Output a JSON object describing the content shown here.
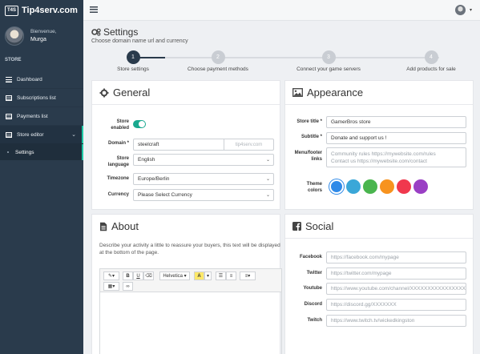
{
  "app": {
    "brand": "Tip4serv.com",
    "logo_text": "T4S"
  },
  "user": {
    "greeting": "Bienvenue,",
    "name": "Murga"
  },
  "sidebar": {
    "section_label": "STORE",
    "items": [
      {
        "label": "Dashboard",
        "icon": "dashboard-icon"
      },
      {
        "label": "Subscriptions list",
        "icon": "list-icon"
      },
      {
        "label": "Payments list",
        "icon": "list-icon"
      },
      {
        "label": "Store editor",
        "icon": "grid-icon",
        "expanded": true
      }
    ],
    "subitems": [
      {
        "label": "Settings"
      }
    ]
  },
  "page": {
    "title": "Settings",
    "subtitle": "Choose domain name url and currency"
  },
  "steps": [
    {
      "number": "1",
      "label": "Store settings",
      "active": true
    },
    {
      "number": "2",
      "label": "Choose payment methods",
      "active": false
    },
    {
      "number": "3",
      "label": "Connect your game servers",
      "active": false
    },
    {
      "number": "4",
      "label": "Add products for sale",
      "active": false
    }
  ],
  "general": {
    "title": "General",
    "store_enabled_label": "Store enabled",
    "store_enabled": true,
    "domain_label": "Domain *",
    "domain_value": "steelcraft",
    "domain_suffix": "tip4serv.com",
    "language_label": "Store language",
    "language_value": "English",
    "timezone_label": "Timezone",
    "timezone_value": "Europe/Berlin",
    "currency_label": "Currency",
    "currency_value": "Please Select Currency"
  },
  "appearance": {
    "title": "Appearance",
    "store_title_label": "Store title *",
    "store_title_value": "GamerBros store",
    "subtitle_label": "Subtitle *",
    "subtitle_value": "Donate and support us !",
    "links_label": "Menu/footer links",
    "links_line1": "Community rules https://mywebsite.com/rules",
    "links_line2": "Contact us https://mywebsite.com/contact",
    "colors_label": "Theme colors",
    "colors": [
      "#2f8ae8",
      "#3aa7d8",
      "#4ab54e",
      "#f7931e",
      "#f0384d",
      "#9a3fc4"
    ]
  },
  "about": {
    "title": "About",
    "description": "Describe your activity a little to reassure your buyers, this text will be displayed at the bottom of the page.",
    "toolbar": {
      "font": "Helvetica",
      "bold": "B",
      "underline": "U"
    }
  },
  "social": {
    "title": "Social",
    "facebook_label": "Facebook",
    "facebook_placeholder": "https://facebook.com/mypage",
    "twitter_label": "Twitter",
    "twitter_placeholder": "https://twitter.com/mypage",
    "youtube_label": "Youtube",
    "youtube_placeholder": "https://www.youtube.com/channel/XXXXXXXXXXXXXXXX",
    "discord_label": "Discord",
    "discord_placeholder": "https://discord.gg/XXXXXXX",
    "twitch_label": "Twitch",
    "twitch_placeholder": "https://www.twitch.tv/wickedkingston"
  }
}
